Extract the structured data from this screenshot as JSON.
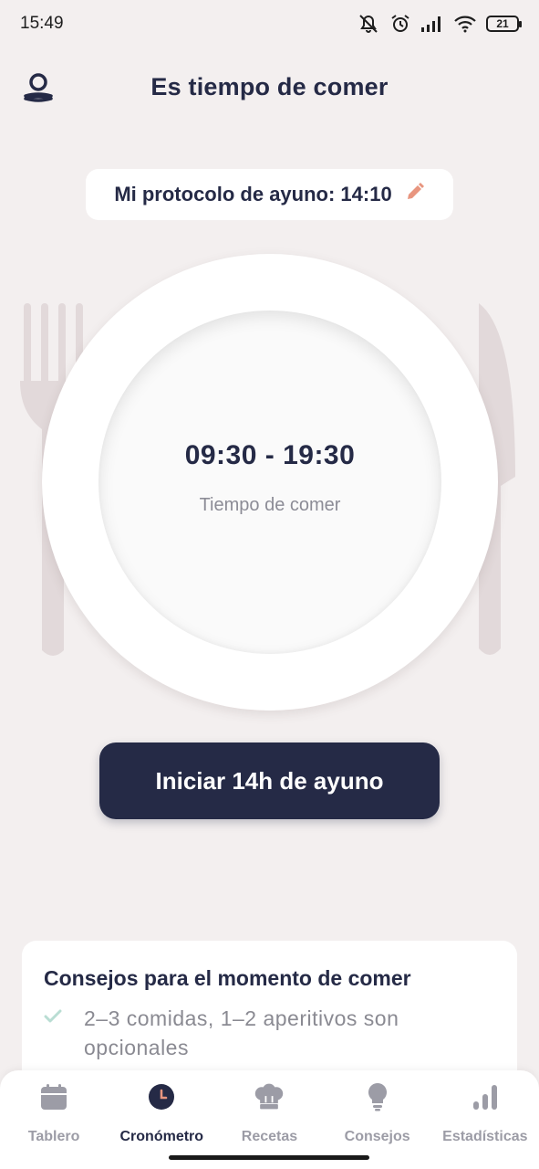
{
  "status_bar": {
    "time": "15:49",
    "battery": "21",
    "icons": [
      "mute-vibrate-icon",
      "alarm-icon",
      "signal-icon",
      "wifi-icon",
      "battery-icon"
    ]
  },
  "header": {
    "title": "Es tiempo de comer",
    "profile_icon": "profile-icon"
  },
  "protocol": {
    "label": "Mi protocolo de ayuno: 14:10",
    "edit_icon": "pencil-icon"
  },
  "plate": {
    "eating_window": "09:30 - 19:30",
    "eating_label": "Tiempo de comer"
  },
  "start_button": {
    "label": "Iniciar 14h de ayuno"
  },
  "tips": {
    "title": "Consejos para el momento de comer",
    "items": [
      {
        "text": "2–3 comidas, 1–2 aperitivos son opcionales",
        "icon": "check-icon"
      }
    ]
  },
  "bottom_nav": {
    "items": [
      {
        "label": "Tablero",
        "icon": "calendar-icon",
        "active": false
      },
      {
        "label": "Cronómetro",
        "icon": "clock-icon",
        "active": true
      },
      {
        "label": "Recetas",
        "icon": "chef-hat-icon",
        "active": false
      },
      {
        "label": "Consejos",
        "icon": "lightbulb-icon",
        "active": false
      },
      {
        "label": "Estadísticas",
        "icon": "bar-chart-icon",
        "active": false
      }
    ]
  },
  "colors": {
    "background": "#f3efef",
    "primary": "#252a46",
    "accent": "#e8957f",
    "muted": "#9c9ca6",
    "check": "#b9ddd3",
    "cutlery": "#e2d9da"
  }
}
